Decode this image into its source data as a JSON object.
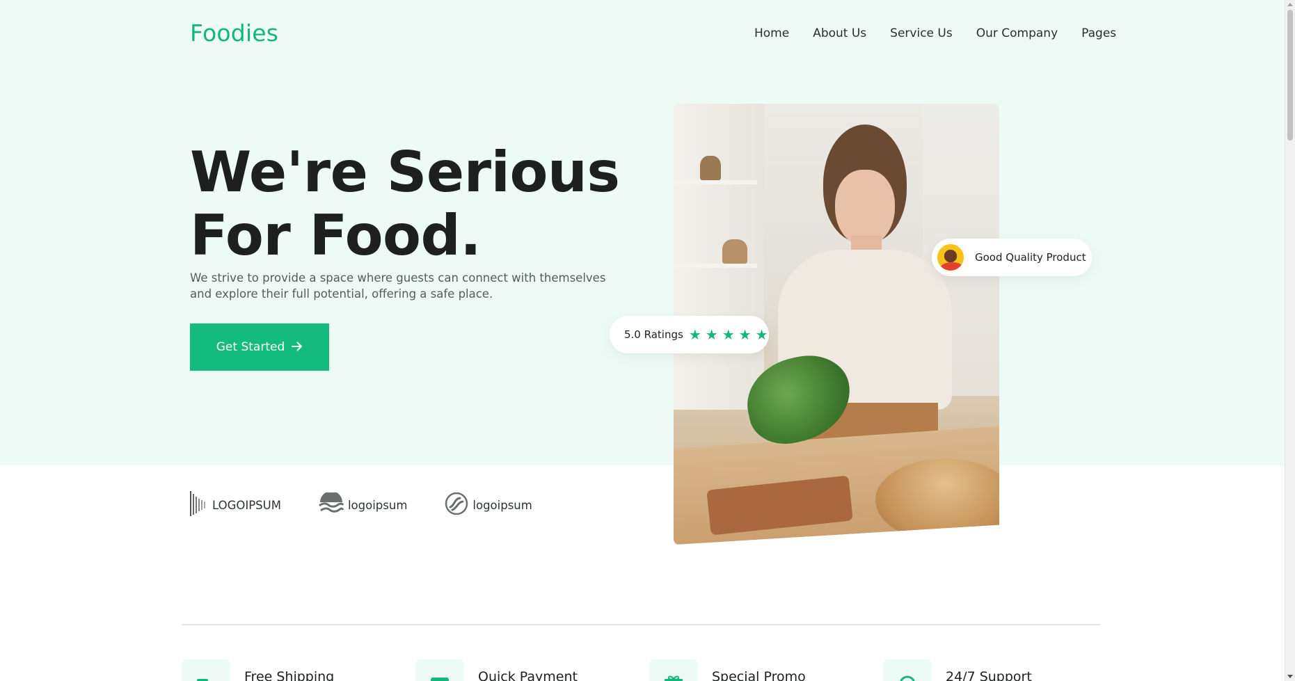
{
  "brand": {
    "name": "Foodies",
    "color": "#12b57a"
  },
  "nav": {
    "items": [
      {
        "label": "Home"
      },
      {
        "label": "About Us"
      },
      {
        "label": "Service Us"
      },
      {
        "label": "Our Company"
      },
      {
        "label": "Pages"
      }
    ]
  },
  "hero": {
    "title": "We're Serious For Food.",
    "description": "We strive to provide a space where guests can connect with themselves and explore their full potential, offering a safe place.",
    "cta_label": "Get Started",
    "cta_icon": "arrow-right-icon",
    "accent_color": "#14bb7e",
    "background_color": "#eefaf5"
  },
  "rating_card": {
    "label": "5.0 Ratings",
    "stars": 5
  },
  "quality_card": {
    "label": "Good Quality Product"
  },
  "logos": [
    {
      "text": "LOGOIPSUM",
      "icon": "sound-bars-logo-icon"
    },
    {
      "text": "logoipsum",
      "icon": "waves-logo-icon"
    },
    {
      "text": "logoipsum",
      "icon": "swirl-circle-logo-icon"
    }
  ],
  "features": [
    {
      "title": "Free Shipping",
      "icon": "truck-icon"
    },
    {
      "title": "Quick Payment",
      "icon": "credit-card-icon"
    },
    {
      "title": "Special Promo",
      "icon": "gift-icon"
    },
    {
      "title": "24/7 Support",
      "icon": "headset-icon"
    }
  ]
}
